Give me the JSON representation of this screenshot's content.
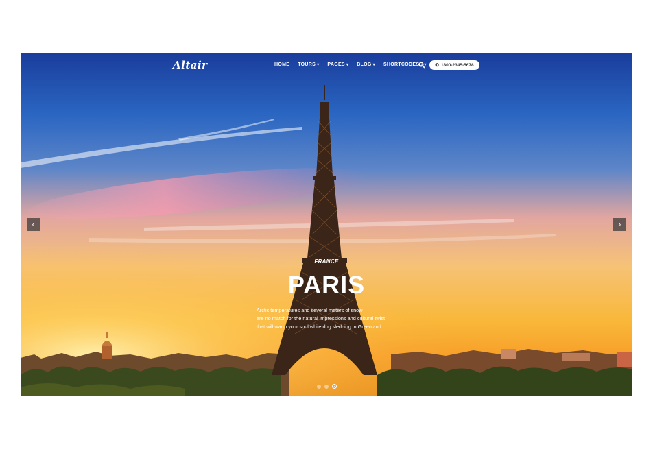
{
  "header": {
    "logo": "Altair",
    "nav": [
      {
        "label": "HOME",
        "has_dropdown": false
      },
      {
        "label": "TOURS",
        "has_dropdown": true
      },
      {
        "label": "PAGES",
        "has_dropdown": true
      },
      {
        "label": "BLOG",
        "has_dropdown": true
      },
      {
        "label": "SHORTCODESS",
        "has_dropdown": true
      }
    ],
    "search_icon": "search-icon",
    "phone_icon": "phone-icon",
    "phone": "1800-2345-5678"
  },
  "slide": {
    "country": "FRANCE",
    "city": "PARIS",
    "description_lines": [
      "Arctic temperatures and several meters of snow",
      "are no match for the natural impressions and cultural twist",
      "that will warm your soul while dog sledding in Greenland."
    ],
    "background": "eiffel-tower-sunset-photo"
  },
  "slider": {
    "prev_icon": "chevron-left-icon",
    "next_icon": "chevron-right-icon",
    "dots_total": 3,
    "active_dot": 3
  },
  "colors": {
    "sky_top": "#1a3d9c",
    "sunset": "#f9b83a",
    "text": "#ffffff"
  }
}
